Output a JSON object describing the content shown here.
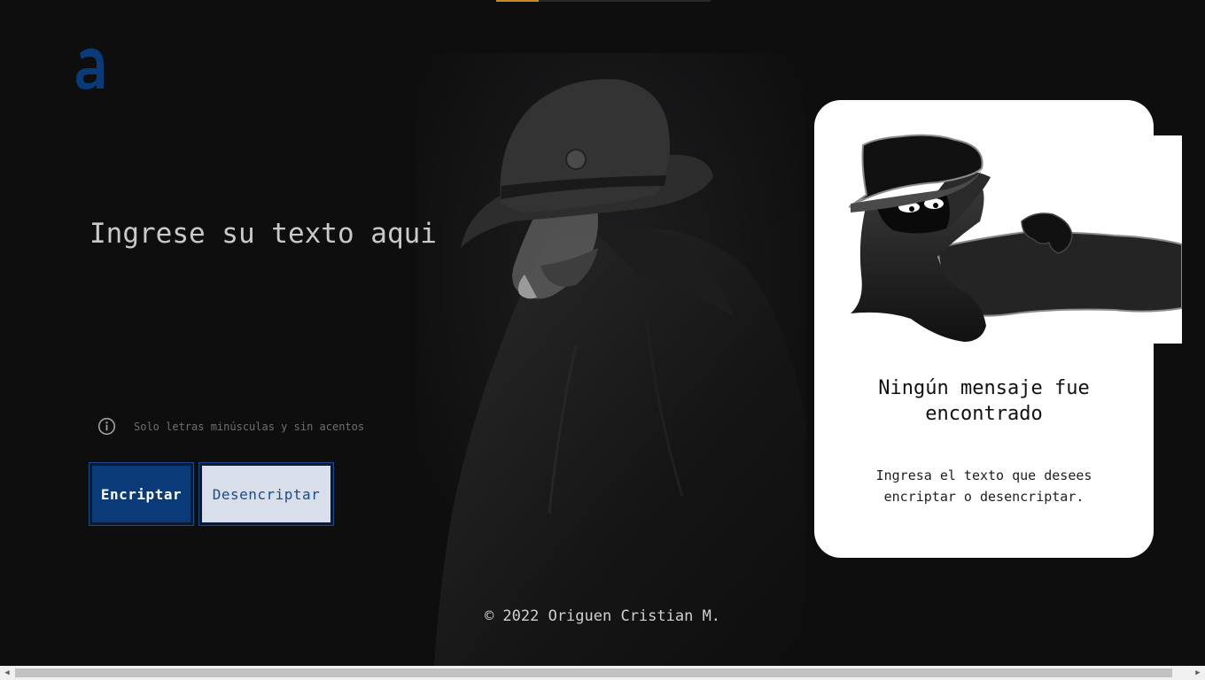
{
  "top_progress": {
    "fraction": 0.2
  },
  "logo": {
    "icon": "alura-a-logo",
    "color": "#0a3a78"
  },
  "input": {
    "placeholder": "Ingrese su texto aqui",
    "value": ""
  },
  "hint": {
    "icon": "info-icon",
    "text": "Solo letras minúsculas y sin acentos"
  },
  "buttons": {
    "encrypt": "Encriptar",
    "decrypt": "Desencriptar"
  },
  "output_card": {
    "illustration": "detective-illustration",
    "title": "Ningún mensaje fue encontrado",
    "text": "Ingresa el texto que desees encriptar o desencriptar."
  },
  "footer": {
    "copyright": "© 2022 Origuen Cristian M."
  },
  "colors": {
    "accent": "#0a3a78",
    "background": "#0e0e0f",
    "progress": "#c98a2a"
  }
}
